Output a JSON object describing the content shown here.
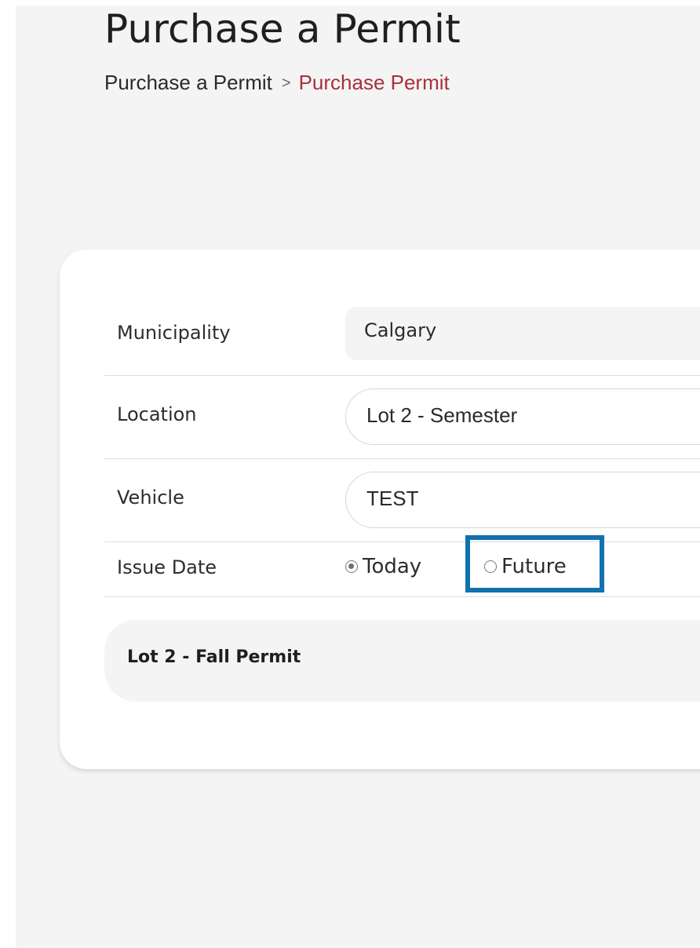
{
  "page": {
    "title": "Purchase a Permit"
  },
  "breadcrumb": {
    "parent": "Purchase a Permit",
    "separator": ">",
    "current": "Purchase Permit"
  },
  "form": {
    "municipality": {
      "label": "Municipality",
      "value": "Calgary"
    },
    "location": {
      "label": "Location",
      "value": "Lot 2 - Semester"
    },
    "vehicle": {
      "label": "Vehicle",
      "value": "TEST"
    },
    "issue_date": {
      "label": "Issue Date",
      "options": [
        {
          "label": "Today",
          "selected": true
        },
        {
          "label": "Future",
          "selected": false
        }
      ]
    }
  },
  "permit": {
    "name": "Lot 2 - Fall Permit"
  },
  "colors": {
    "breadcrumb_current": "#a8313a",
    "highlight": "#1172ad",
    "page_background": "#f4f4f4"
  }
}
